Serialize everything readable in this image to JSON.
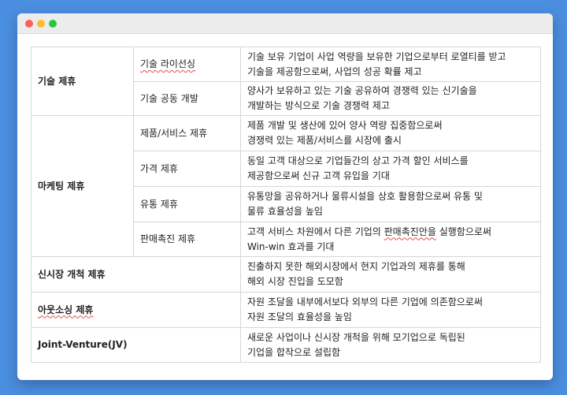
{
  "rows": [
    {
      "category": "기술 제휴",
      "subs": [
        {
          "name": "기술 라이선싱",
          "desc1": "기술 보유 기업이 사업 역량을 보유한 기업으로부터 로열티를 받고",
          "desc2": "기술을 제공함으로써, 사업의 성공 확률 제고"
        },
        {
          "name": "기술 공동 개발",
          "desc1": "양사가 보유하고 있는 기술 공유하여 경쟁력 있는 신기술을",
          "desc2": "개발하는 방식으로 기술 경쟁력 제고"
        }
      ]
    },
    {
      "category": "마케팅 제휴",
      "subs": [
        {
          "name": "제품/서비스 제휴",
          "desc1": "제품 개발 및 생산에 있어 양사 역량 집중함으로써",
          "desc2": "경쟁력 있는 제품/서비스를 시장에 출시"
        },
        {
          "name": "가격 제휴",
          "desc1": "동일 고객 대상으로 기업들간의 상고 가격 할인 서비스를",
          "desc2": "제공함으로써 신규 고객 유입을 기대"
        },
        {
          "name": "유통 제휴",
          "desc1": "유통망을 공유하거나 물류시설을 상호 활용함으로써 유통 및",
          "desc2": "물류 효율성을 높임"
        },
        {
          "name": "판매촉진 제휴",
          "desc1_pre": "고객 서비스 차원에서 다른 기업의 ",
          "desc1_mark": "판매촉진안을",
          "desc1_post": " 실행함으로써",
          "desc2": "Win-win 효과를 기대"
        }
      ]
    },
    {
      "category": "신시장 개척 제휴",
      "desc1": "진출하지 못한 해외시장에서 현지 기업과의 제휴를 통해",
      "desc2": "해외 시장 진입을 도모함"
    },
    {
      "category": "아웃소싱 제휴",
      "desc1": "자원 조달을 내부에서보다 외부의 다른 기업에 의존함으로써",
      "desc2": "자원 조달의 효율성을 높임"
    },
    {
      "category": "Joint-Venture(JV)",
      "desc1": "새로운 사업이나 신시장 개척을 위해 모기업으로 독립된",
      "desc2": "기업을 합작으로 설립함"
    }
  ],
  "colors": {
    "category_text": "#1414d8",
    "background": "#4a8ee0",
    "border": "#d6d6d6"
  }
}
